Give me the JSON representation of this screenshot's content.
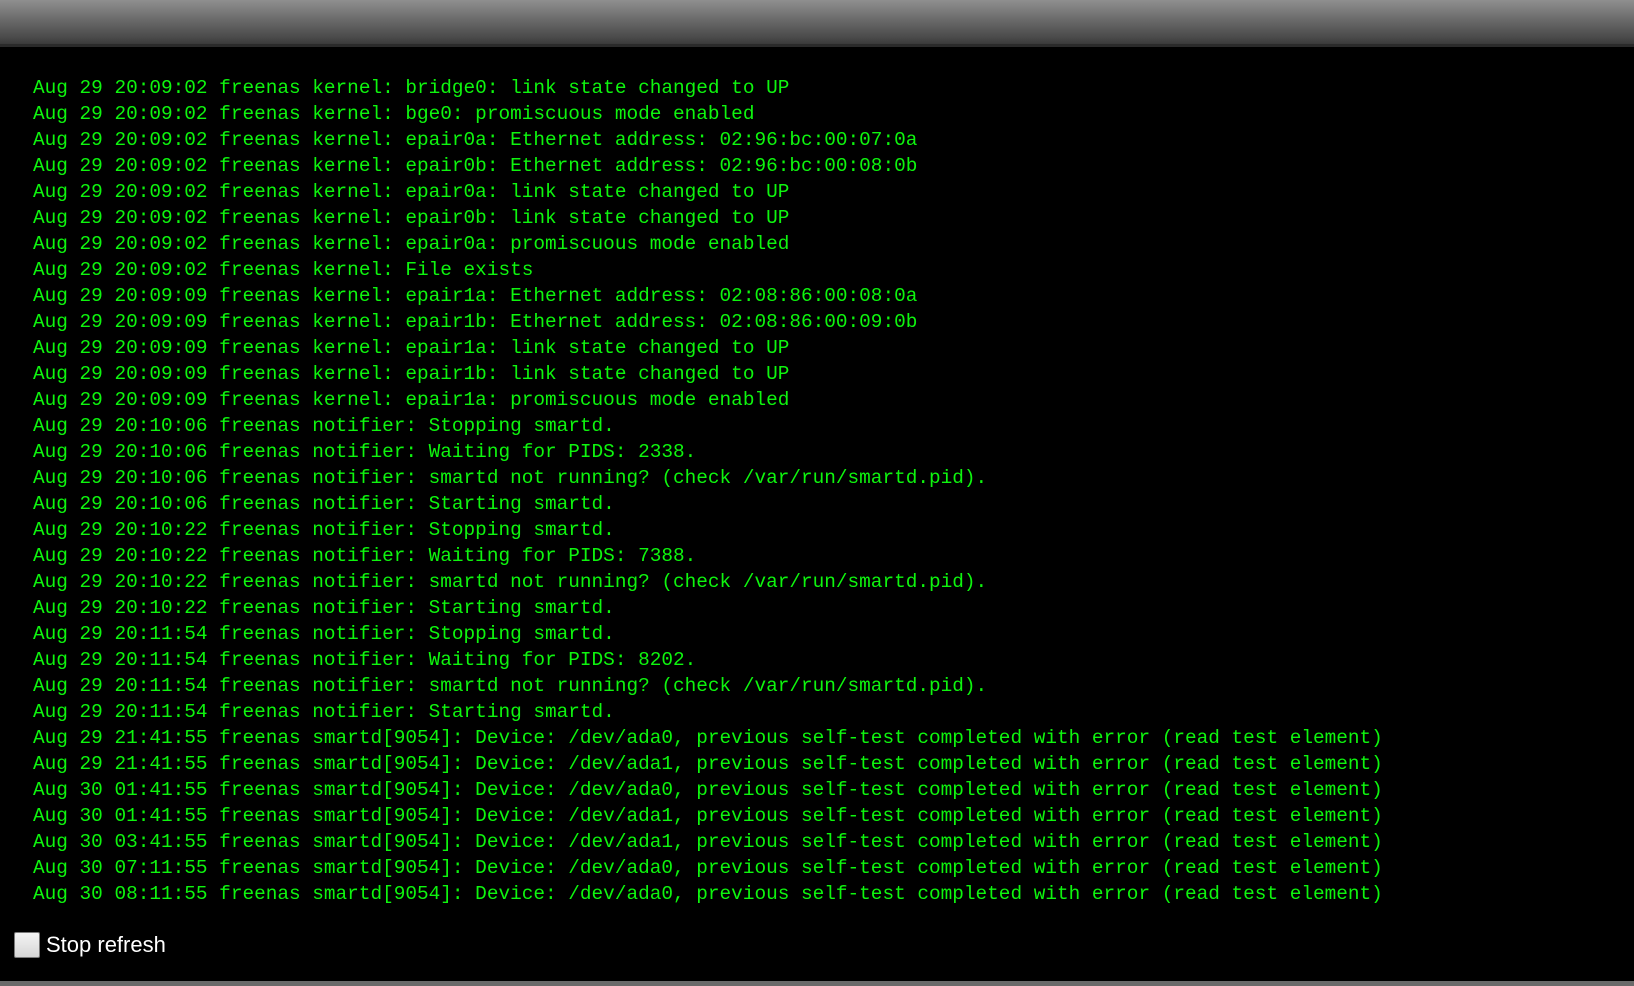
{
  "log": {
    "lines": [
      "Aug 29 20:09:02 freenas kernel: bridge0: link state changed to UP",
      "Aug 29 20:09:02 freenas kernel: bge0: promiscuous mode enabled",
      "Aug 29 20:09:02 freenas kernel: epair0a: Ethernet address: 02:96:bc:00:07:0a",
      "Aug 29 20:09:02 freenas kernel: epair0b: Ethernet address: 02:96:bc:00:08:0b",
      "Aug 29 20:09:02 freenas kernel: epair0a: link state changed to UP",
      "Aug 29 20:09:02 freenas kernel: epair0b: link state changed to UP",
      "Aug 29 20:09:02 freenas kernel: epair0a: promiscuous mode enabled",
      "Aug 29 20:09:02 freenas kernel: File exists",
      "Aug 29 20:09:09 freenas kernel: epair1a: Ethernet address: 02:08:86:00:08:0a",
      "Aug 29 20:09:09 freenas kernel: epair1b: Ethernet address: 02:08:86:00:09:0b",
      "Aug 29 20:09:09 freenas kernel: epair1a: link state changed to UP",
      "Aug 29 20:09:09 freenas kernel: epair1b: link state changed to UP",
      "Aug 29 20:09:09 freenas kernel: epair1a: promiscuous mode enabled",
      "Aug 29 20:10:06 freenas notifier: Stopping smartd.",
      "Aug 29 20:10:06 freenas notifier: Waiting for PIDS: 2338.",
      "Aug 29 20:10:06 freenas notifier: smartd not running? (check /var/run/smartd.pid).",
      "Aug 29 20:10:06 freenas notifier: Starting smartd.",
      "Aug 29 20:10:22 freenas notifier: Stopping smartd.",
      "Aug 29 20:10:22 freenas notifier: Waiting for PIDS: 7388.",
      "Aug 29 20:10:22 freenas notifier: smartd not running? (check /var/run/smartd.pid).",
      "Aug 29 20:10:22 freenas notifier: Starting smartd.",
      "Aug 29 20:11:54 freenas notifier: Stopping smartd.",
      "Aug 29 20:11:54 freenas notifier: Waiting for PIDS: 8202.",
      "Aug 29 20:11:54 freenas notifier: smartd not running? (check /var/run/smartd.pid).",
      "Aug 29 20:11:54 freenas notifier: Starting smartd.",
      "Aug 29 21:41:55 freenas smartd[9054]: Device: /dev/ada0, previous self-test completed with error (read test element)",
      "Aug 29 21:41:55 freenas smartd[9054]: Device: /dev/ada1, previous self-test completed with error (read test element)",
      "Aug 30 01:41:55 freenas smartd[9054]: Device: /dev/ada0, previous self-test completed with error (read test element)",
      "Aug 30 01:41:55 freenas smartd[9054]: Device: /dev/ada1, previous self-test completed with error (read test element)",
      "Aug 30 03:41:55 freenas smartd[9054]: Device: /dev/ada1, previous self-test completed with error (read test element)",
      "Aug 30 07:11:55 freenas smartd[9054]: Device: /dev/ada0, previous self-test completed with error (read test element)",
      "Aug 30 08:11:55 freenas smartd[9054]: Device: /dev/ada0, previous self-test completed with error (read test element)"
    ],
    "text_color": "#0ef50e",
    "background_color": "#000000"
  },
  "controls": {
    "stop_refresh_label": "Stop refresh",
    "stop_refresh_checked": false
  }
}
